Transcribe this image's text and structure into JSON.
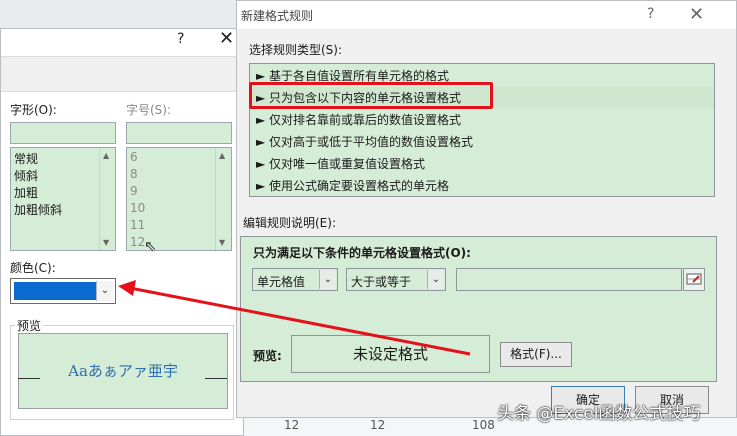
{
  "background": {
    "cells": [
      "12",
      "12",
      "108"
    ]
  },
  "font_dialog": {
    "help_glyph": "?",
    "close_glyph": "✕",
    "style_label": "字形(O):",
    "size_label": "字号(S):",
    "styles": [
      "常规",
      "倾斜",
      "加粗",
      "加粗倾斜"
    ],
    "sizes": [
      "6",
      "8",
      "9",
      "10",
      "11",
      "12"
    ],
    "color_label": "颜色(C):",
    "color_value": "#0a6ad0",
    "preview_label": "预览",
    "preview_text": "Aaあぁアァ亜宇"
  },
  "rule_dialog": {
    "title": "新建格式规则",
    "help_glyph": "?",
    "close_glyph": "✕",
    "rule_type_label": "选择规则类型(S):",
    "rule_types": [
      "► 基于各自值设置所有单元格的格式",
      "► 只为包含以下内容的单元格设置格式",
      "► 仅对排名靠前或靠后的数值设置格式",
      "► 仅对高于或低于平均值的数值设置格式",
      "► 仅对唯一值或重复值设置格式",
      "► 使用公式确定要设置格式的单元格"
    ],
    "desc_label": "编辑规则说明(E):",
    "condition_title": "只为满足以下条件的单元格设置格式(O):",
    "combo1": "单元格值",
    "combo2": "大于或等于",
    "combo3": "",
    "preview_label": "预览:",
    "preview_value": "未设定格式",
    "format_button": "格式(F)...",
    "ok_button": "确定",
    "cancel_button": "取消"
  },
  "watermark": "头条 @Excel函数公式技巧",
  "colors": {
    "highlight_red": "#e5101a",
    "panel_green": "#d5ecd6",
    "swatch_blue": "#0a6ad0"
  }
}
